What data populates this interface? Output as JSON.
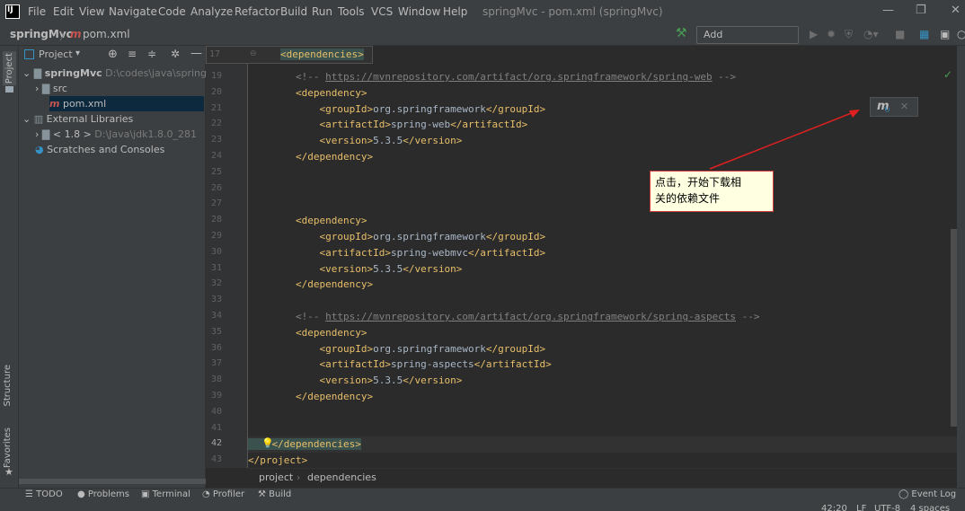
{
  "menu": [
    "File",
    "Edit",
    "View",
    "Navigate",
    "Code",
    "Analyze",
    "Refactor",
    "Build",
    "Run",
    "Tools",
    "VCS",
    "Window",
    "Help"
  ],
  "window_title": "springMvc - pom.xml (springMvc)",
  "window_controls": {
    "minimize": "—",
    "maximize": "❐",
    "close": "✕"
  },
  "nav": {
    "project": "springMvc",
    "separator": "〉",
    "file": "pom.xml",
    "add_config": "Add Configuration..."
  },
  "side_tabs": {
    "project": "Project",
    "structure": "Structure",
    "favorites": "Favorites"
  },
  "project_panel": {
    "title": "Project",
    "tree": [
      {
        "label": "springMvc",
        "path": "D:\\codes\\java\\springMv"
      },
      {
        "label": "src"
      },
      {
        "label": "pom.xml"
      },
      {
        "label": "External Libraries"
      },
      {
        "label": "< 1.8 >",
        "path": "D:\\Java\\jdk1.8.0_281"
      },
      {
        "label": "Scratches and Consoles"
      }
    ]
  },
  "editor": {
    "sticky_line": "17",
    "sticky_text": "<dependencies>",
    "lines": [
      {
        "num": "19",
        "text": "        <!-- ",
        "url": "https://mvnrepository.com/artifact/org.springframework/spring-web",
        "tail": " -->",
        "kind": "comment"
      },
      {
        "num": "20",
        "text": "        <dependency>",
        "kind": "tag"
      },
      {
        "num": "21",
        "open": "            <groupId>",
        "value": "org.springframework",
        "close": "</groupId>",
        "kind": "elem"
      },
      {
        "num": "22",
        "open": "            <artifactId>",
        "value": "spring-web",
        "close": "</artifactId>",
        "kind": "elem"
      },
      {
        "num": "23",
        "open": "            <version>",
        "value": "5.3.5",
        "close": "</version>",
        "kind": "elem"
      },
      {
        "num": "24",
        "text": "        </dependency>",
        "kind": "tag"
      },
      {
        "num": "25",
        "text": "",
        "kind": "tag"
      },
      {
        "num": "26",
        "text": "",
        "kind": "tag"
      },
      {
        "num": "27",
        "text": "",
        "kind": "tag"
      },
      {
        "num": "28",
        "text": "        <dependency>",
        "kind": "tag"
      },
      {
        "num": "29",
        "open": "            <groupId>",
        "value": "org.springframework",
        "close": "</groupId>",
        "kind": "elem"
      },
      {
        "num": "30",
        "open": "            <artifactId>",
        "value": "spring-webmvc",
        "close": "</artifactId>",
        "kind": "elem"
      },
      {
        "num": "31",
        "open": "            <version>",
        "value": "5.3.5",
        "close": "</version>",
        "kind": "elem"
      },
      {
        "num": "32",
        "text": "        </dependency>",
        "kind": "tag"
      },
      {
        "num": "33",
        "text": "",
        "kind": "tag"
      },
      {
        "num": "34",
        "text": "        <!-- ",
        "url": "https://mvnrepository.com/artifact/org.springframework/spring-aspects",
        "tail": " -->",
        "kind": "comment"
      },
      {
        "num": "35",
        "text": "        <dependency>",
        "kind": "tag"
      },
      {
        "num": "36",
        "open": "            <groupId>",
        "value": "org.springframework",
        "close": "</groupId>",
        "kind": "elem"
      },
      {
        "num": "37",
        "open": "            <artifactId>",
        "value": "spring-aspects",
        "close": "</artifactId>",
        "kind": "elem"
      },
      {
        "num": "38",
        "open": "            <version>",
        "value": "5.3.5",
        "close": "</version>",
        "kind": "elem"
      },
      {
        "num": "39",
        "text": "        </dependency>",
        "kind": "tag"
      },
      {
        "num": "40",
        "text": "",
        "kind": "tag"
      },
      {
        "num": "41",
        "text": "",
        "kind": "tag"
      },
      {
        "num": "42",
        "text": "    </dependencies>",
        "kind": "current"
      },
      {
        "num": "43",
        "text": "</project>",
        "kind": "tag"
      }
    ]
  },
  "breadcrumbs": [
    "project",
    "dependencies"
  ],
  "bottom_tools": [
    "TODO",
    "Problems",
    "Terminal",
    "Profiler",
    "Build",
    "Event Log"
  ],
  "status": {
    "position": "42:20",
    "line_sep": "LF",
    "encoding": "UTF-8",
    "indent": "4 spaces"
  },
  "annotation": {
    "line1": "点击，开始下载相",
    "line2": "关的依赖文件"
  },
  "colors": {
    "arrow": "#e02020",
    "tag": "#e8bf6a",
    "text": "#a9b7c6",
    "comment": "#808080"
  }
}
